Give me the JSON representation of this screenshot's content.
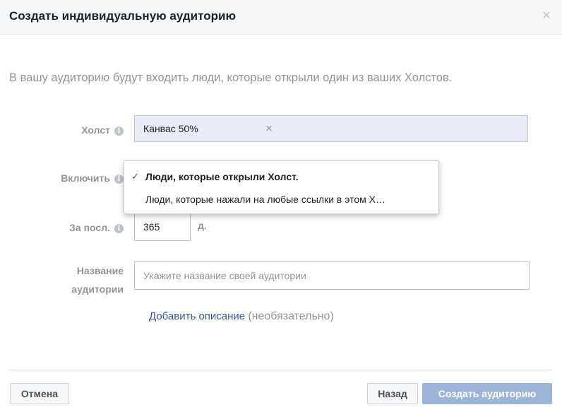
{
  "dialog": {
    "title": "Создать индивидуальную аудиторию",
    "close_label": "×"
  },
  "intro_text": "В вашу аудиторию будут входить люди, которые открыли один из ваших Холстов.",
  "form": {
    "canvas": {
      "label": "Холст",
      "selected_token": "Канвас 50%",
      "remove_label": "×"
    },
    "include": {
      "label": "Включить",
      "options": [
        {
          "label": "Люди, которые открыли Холст.",
          "selected": true
        },
        {
          "label": "Люди, которые нажали на любые ссылки в этом Х…",
          "selected": false
        }
      ],
      "check_glyph": "✓"
    },
    "retention": {
      "label": "За посл.",
      "value": "365",
      "unit": "д."
    },
    "audience_name": {
      "label": "Название аудитории",
      "placeholder": "Укажите название своей аудитории",
      "value": ""
    },
    "description": {
      "link_text": "Добавить описание",
      "optional_text": "(необязательно)"
    }
  },
  "footer": {
    "cancel_label": "Отмена",
    "back_label": "Назад",
    "create_label": "Создать аудиторию"
  },
  "colors": {
    "primary_disabled": "#9cb4d8",
    "link": "#365899",
    "token_bg": "#e9ebf7",
    "muted_text": "#90949c"
  },
  "icons": {
    "info": "info-icon",
    "close": "close-icon",
    "check": "checkmark-icon"
  }
}
